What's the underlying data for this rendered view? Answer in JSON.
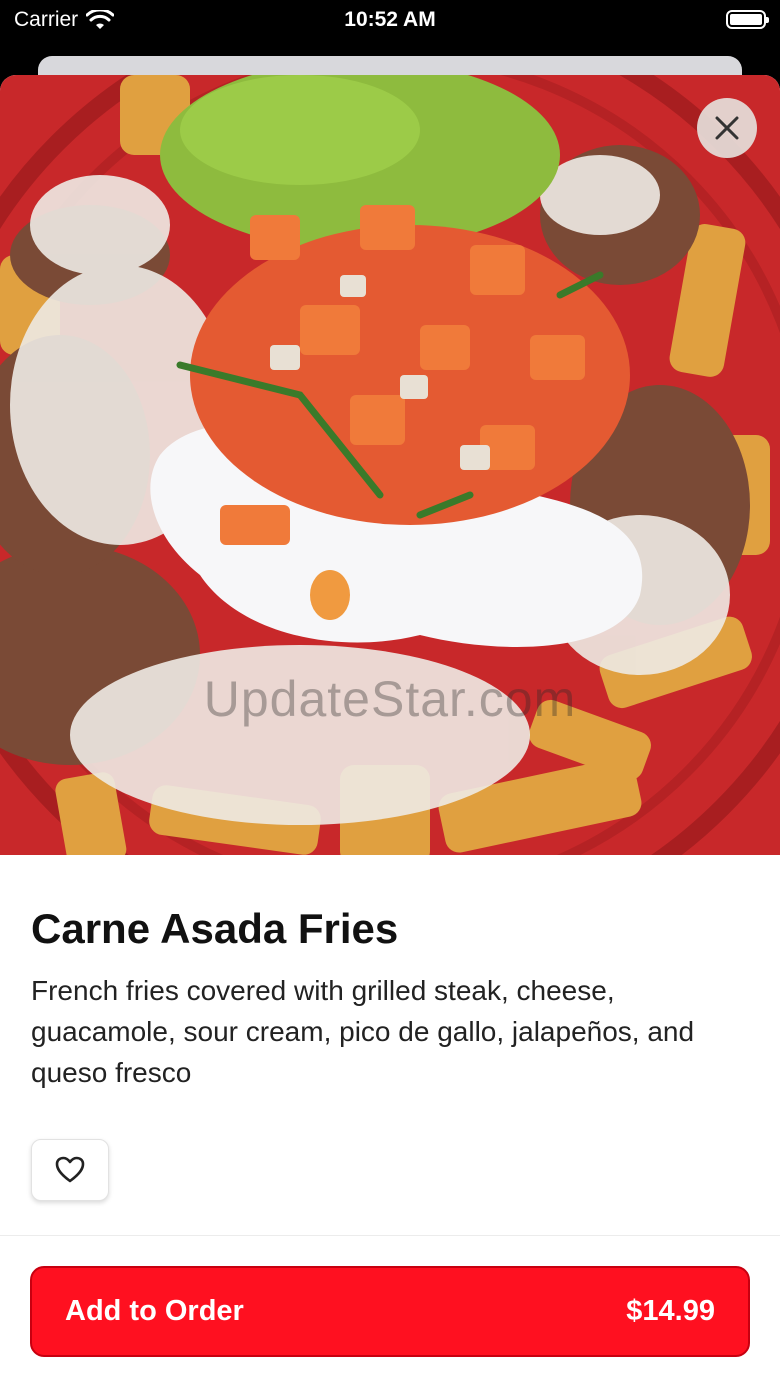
{
  "status_bar": {
    "carrier": "Carrier",
    "time": "10:52 AM"
  },
  "item": {
    "title": "Carne Asada Fries",
    "description": "French fries covered with grilled steak, cheese, guacamole, sour cream, pico de gallo, jalapeños, and queso fresco",
    "image_watermark": "UpdateStar.com"
  },
  "order_button": {
    "label": "Add to Order",
    "price": "$14.99"
  },
  "icons": {
    "close": "close-icon",
    "favorite": "heart-icon",
    "wifi": "wifi-icon",
    "battery": "battery-icon"
  },
  "colors": {
    "accent": "#ff1020",
    "plate": "#c8282a"
  }
}
